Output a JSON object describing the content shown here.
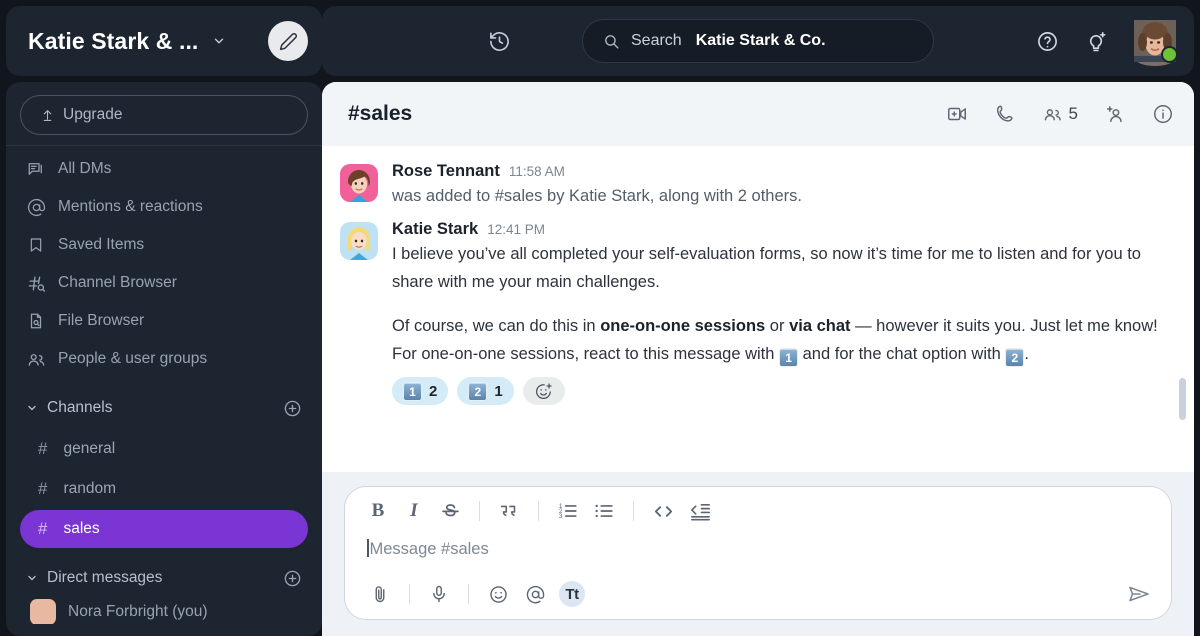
{
  "workspace": {
    "title": "Katie Stark & ...",
    "chevron_icon": "chevron-down-icon",
    "compose_icon": "pencil-icon"
  },
  "sidebar": {
    "upgrade_label": "Upgrade",
    "upgrade_icon": "upgrade-arrow-icon",
    "nav_items": [
      {
        "label": "All DMs",
        "icon": "all-dms-icon"
      },
      {
        "label": "Mentions & reactions",
        "icon": "at-sign-icon"
      },
      {
        "label": "Saved Items",
        "icon": "bookmark-icon"
      },
      {
        "label": "Channel Browser",
        "icon": "channel-search-icon"
      },
      {
        "label": "File Browser",
        "icon": "file-search-icon"
      },
      {
        "label": "People & user groups",
        "icon": "people-icon"
      }
    ],
    "channels_section": {
      "label": "Channels",
      "caret_icon": "chevron-down-icon",
      "add_icon": "plus-circle-icon",
      "items": [
        {
          "label": "general",
          "hash": "#",
          "active": false
        },
        {
          "label": "random",
          "hash": "#",
          "active": false
        },
        {
          "label": "sales",
          "hash": "#",
          "active": true
        }
      ]
    },
    "dm_section": {
      "label": "Direct messages",
      "caret_icon": "chevron-down-icon",
      "add_icon": "plus-circle-icon",
      "peek_item": "Nora Forbright (you)"
    }
  },
  "topbar": {
    "history_icon": "history-clock-icon",
    "search": {
      "icon": "search-icon",
      "label": "Search",
      "workspace": "Katie Stark & Co."
    },
    "help_icon": "help-circle-icon",
    "ideas_icon": "lightbulb-sparkle-icon",
    "avatar_name": "user-avatar",
    "presence": "online",
    "presence_color": "#6fc234"
  },
  "channel": {
    "name": "#sales",
    "actions": {
      "video_icon": "video-call-icon",
      "call_icon": "phone-call-icon",
      "members_icon": "members-icon",
      "member_count": "5",
      "add_member_icon": "add-member-icon",
      "info_icon": "info-circle-icon"
    }
  },
  "messages": [
    {
      "author": "Rose Tennant",
      "time": "11:58 AM",
      "avatar": "rose-tennant-avatar",
      "system": true,
      "text": "was added to #sales by Katie Stark, along with 2 others."
    },
    {
      "author": "Katie Stark",
      "time": "12:41 PM",
      "avatar": "katie-stark-avatar",
      "system": false,
      "paragraph1": "I believe you’ve all completed your self-evaluation forms, so now it’s time for me to listen and for you to share with me your main challenges.",
      "p2_part1": "Of course, we can do this in ",
      "p2_bold1": "one-on-one sessions",
      "p2_part2": " or ",
      "p2_bold2": "via chat",
      "p2_part3": " — however it suits you. Just let me know!  For one-on-one sessions, react to this message with ",
      "p2_emoji1": "1",
      "p2_part4": " and for the chat option with ",
      "p2_emoji2": "2",
      "p2_part5": ".",
      "reactions": [
        {
          "emoji": "1",
          "count": "2"
        },
        {
          "emoji": "2",
          "count": "1"
        }
      ],
      "add_reaction_icon": "add-reaction-icon"
    }
  ],
  "composer": {
    "placeholder": "Message #sales",
    "format_buttons": [
      {
        "name": "bold",
        "glyph": "B"
      },
      {
        "name": "italic",
        "glyph": "I"
      },
      {
        "name": "strikethrough",
        "glyph": "S"
      },
      {
        "name": "blockquote",
        "glyph": "””"
      },
      {
        "name": "ordered-list",
        "glyph": ""
      },
      {
        "name": "bulleted-list",
        "glyph": ""
      },
      {
        "name": "inline-code",
        "glyph": "<>"
      },
      {
        "name": "code-block",
        "glyph": ""
      }
    ],
    "attach_icon": "paperclip-icon",
    "mic_icon": "microphone-icon",
    "emoji_icon": "emoji-icon",
    "mention_icon": "at-mention-icon",
    "text_format_icon": "Tt",
    "send_icon": "send-icon"
  },
  "colors": {
    "accent": "#7b35d4",
    "sidebar_bg": "#1d2530",
    "panel_bg": "#f2f5f8",
    "reaction_bg": "#d3ecf7"
  }
}
